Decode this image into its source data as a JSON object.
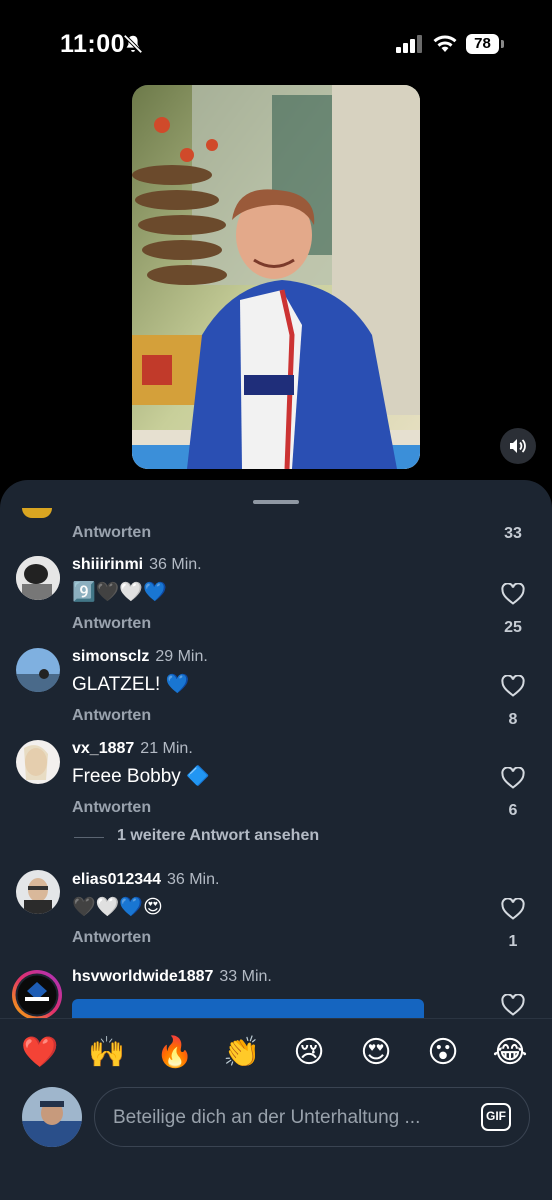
{
  "status_bar": {
    "time": "11:00",
    "battery": "78"
  },
  "video": {
    "description_colors": {
      "jacket": "#2a4fb3",
      "background": "#c9cfa0"
    }
  },
  "comments": {
    "top_partial": {
      "likes": "33",
      "reply_label": "Antworten"
    },
    "items": [
      {
        "username": "shiiirinmi",
        "time": "36 Min.",
        "text": "9️⃣🖤🤍💙",
        "reply_label": "Antworten",
        "likes": "25"
      },
      {
        "username": "simonsclz",
        "time": "29 Min.",
        "text": "GLATZEL! 💙",
        "reply_label": "Antworten",
        "likes": "8"
      },
      {
        "username": "vx_1887",
        "time": "21 Min.",
        "text": "Freee Bobby 🔷",
        "reply_label": "Antworten",
        "likes": "6",
        "more_replies": "1 weitere Antwort ansehen"
      },
      {
        "username": "elias012344",
        "time": "36 Min.",
        "text": "🖤🤍💙😍",
        "reply_label": "Antworten",
        "likes": "1"
      },
      {
        "username": "hsvworldwide1887",
        "time": "33 Min."
      }
    ]
  },
  "reactions": [
    "❤️",
    "🙌",
    "🔥",
    "👏",
    "😢",
    "😍",
    "😮",
    "😂"
  ],
  "composer": {
    "placeholder": "Beteilige dich an der Unterhaltung ...",
    "gif_label": "GIF"
  },
  "colors": {
    "sheet_bg": "#1c2531",
    "heart_blue": "#2f8cf0",
    "secondary_text": "#9aa3ae"
  }
}
